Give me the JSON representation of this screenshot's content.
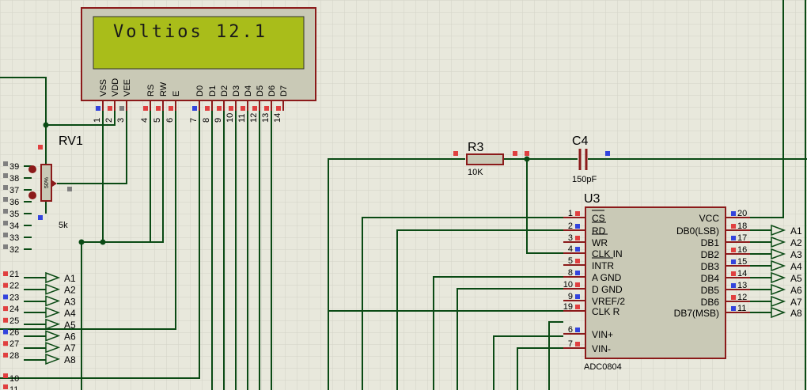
{
  "lcd": {
    "display_text": "Voltios 12.1",
    "pin_names": [
      "VSS",
      "VDD",
      "VEE",
      "RS",
      "RW",
      "E",
      "D0",
      "D1",
      "D2",
      "D3",
      "D4",
      "D5",
      "D6",
      "D7"
    ],
    "pin_numbers": [
      "1",
      "2",
      "3",
      "4",
      "5",
      "6",
      "7",
      "8",
      "9",
      "10",
      "11",
      "12",
      "13",
      "14"
    ]
  },
  "pot": {
    "ref": "RV1",
    "value": "5k",
    "wiper": "50%"
  },
  "resistor": {
    "ref": "R3",
    "value": "10K"
  },
  "capacitor": {
    "ref": "C4",
    "value": "150pF"
  },
  "adc": {
    "ref": "U3",
    "part": "ADC0804",
    "left_pins": [
      {
        "num": "1",
        "name": "CS"
      },
      {
        "num": "2",
        "name": "RD"
      },
      {
        "num": "3",
        "name": "WR"
      },
      {
        "num": "4",
        "name": "CLK IN"
      },
      {
        "num": "5",
        "name": "INTR"
      },
      {
        "num": "8",
        "name": "A GND"
      },
      {
        "num": "10",
        "name": "D GND"
      },
      {
        "num": "9",
        "name": "VREF/2"
      },
      {
        "num": "19",
        "name": "CLK R"
      },
      {
        "num": "6",
        "name": "VIN+"
      },
      {
        "num": "7",
        "name": "VIN-"
      }
    ],
    "right_pins": [
      {
        "num": "20",
        "name": "VCC"
      },
      {
        "num": "18",
        "name": "DB0(LSB)"
      },
      {
        "num": "17",
        "name": "DB1"
      },
      {
        "num": "16",
        "name": "DB2"
      },
      {
        "num": "15",
        "name": "DB3"
      },
      {
        "num": "14",
        "name": "DB4"
      },
      {
        "num": "13",
        "name": "DB5"
      },
      {
        "num": "12",
        "name": "DB6"
      },
      {
        "num": "11",
        "name": "DB7(MSB)"
      }
    ],
    "right_net_labels": [
      "A1",
      "A2",
      "A3",
      "A4",
      "A5",
      "A6",
      "A7",
      "A8"
    ]
  },
  "mcu": {
    "top_pin_numbers": [
      "39",
      "38",
      "37",
      "36",
      "35",
      "34",
      "33",
      "32"
    ],
    "mid_pin_numbers": [
      "21",
      "22",
      "23",
      "24",
      "25",
      "26",
      "27",
      "28"
    ],
    "mid_net_labels": [
      "A1",
      "A2",
      "A3",
      "A4",
      "A5",
      "A6",
      "A7",
      "A8"
    ],
    "bottom_pin_numbers": [
      "10",
      "11"
    ]
  },
  "colors": {
    "background": "#e8e8dc",
    "grid": "#d0d0c4",
    "wire": "#0a4a14",
    "component_outline": "#8b1a1a",
    "ic_fill": "#c9c9b6",
    "lcd_bezel": "#c9c9b6",
    "lcd_screen": "#a9bd1a",
    "pin_red": "#e04040",
    "pin_blue": "#3344dd",
    "pin_grey": "#808080"
  }
}
